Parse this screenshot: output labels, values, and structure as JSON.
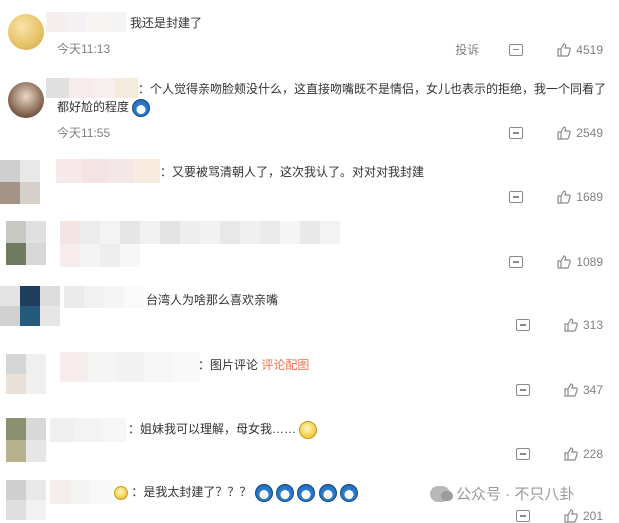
{
  "comments": [
    {
      "text": "我还是封建了",
      "time": "今天11:13",
      "report_label": "投诉",
      "likes": "4519"
    },
    {
      "prefix": "：",
      "text_line1": "个人觉得亲吻脸颊没什么，这直接吻嘴既不是情侣，女儿也表示的拒绝，我一个同看了",
      "text_line2": "都好尬的程度",
      "time": "今天11:55",
      "likes": "2549"
    },
    {
      "prefix": "：",
      "text": "又要被骂清朝人了，这次我认了。对对对我封建",
      "likes": "1689"
    },
    {
      "likes": "1089"
    },
    {
      "text": "台湾人为啥那么喜欢亲嘴",
      "likes": "313"
    },
    {
      "prefix": "：",
      "text": "图片评论",
      "link": "评论配图",
      "likes": "347"
    },
    {
      "prefix": "：",
      "text": "姐妹我可以理解，母女我……",
      "likes": "228"
    },
    {
      "prefix": "：",
      "text": "是我太封建了？？？",
      "likes": "201"
    }
  ],
  "watermark": "公众号 · 不只八卦",
  "icons": {
    "reply": "comment-icon",
    "like": "thumb-up-icon",
    "emoji_blue": "doge-emoji-icon",
    "emoji_yellow": "smile-emoji-icon"
  }
}
